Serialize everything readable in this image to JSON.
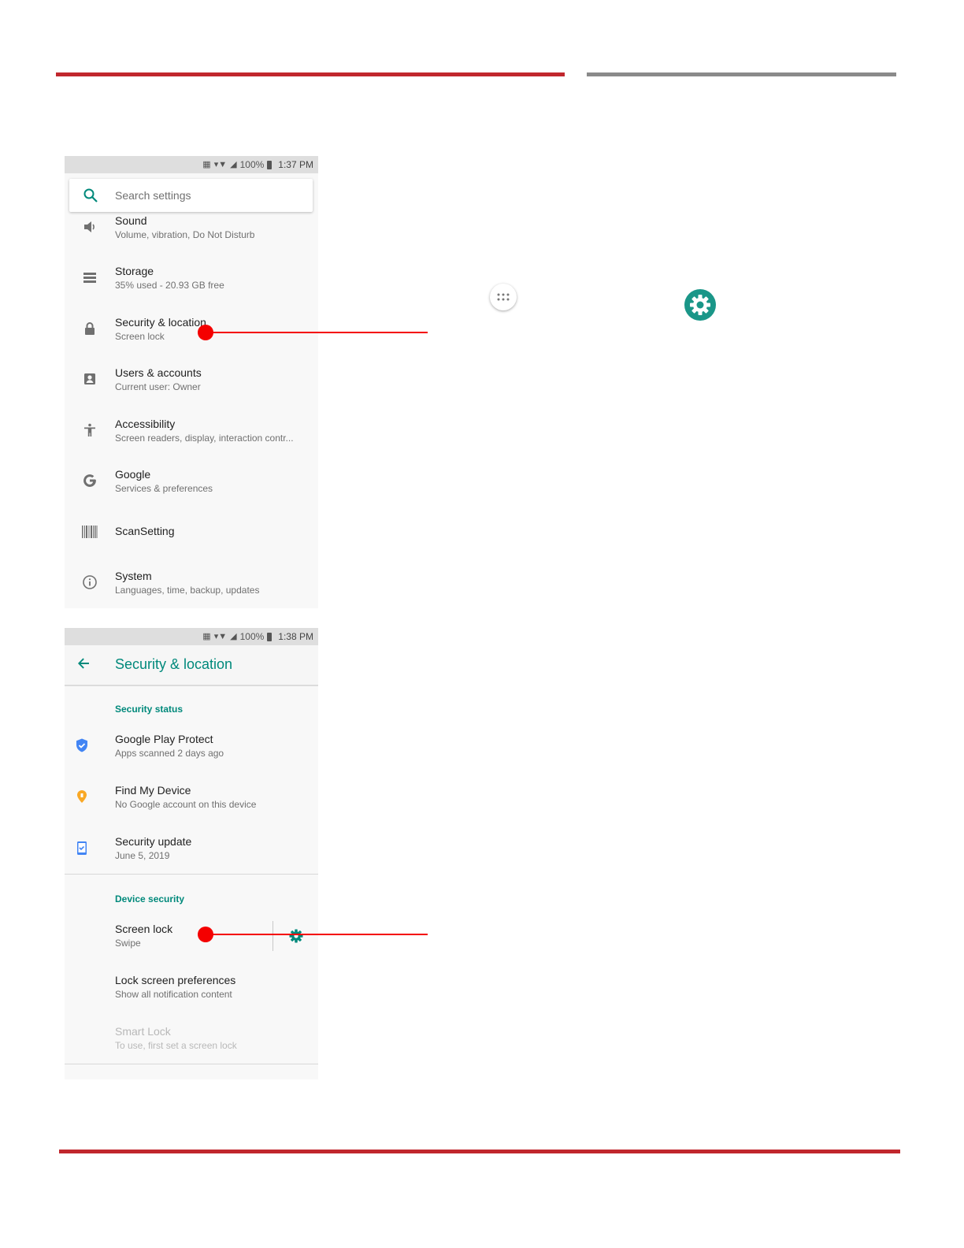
{
  "shot1": {
    "status": {
      "battery": "100%",
      "time": "1:37 PM"
    },
    "search_placeholder": "Search settings",
    "items": [
      {
        "title": "Sound",
        "subtitle": "Volume, vibration, Do Not Disturb",
        "icon": "volume-icon"
      },
      {
        "title": "Storage",
        "subtitle": "35% used - 20.93 GB free",
        "icon": "storage-icon"
      },
      {
        "title": "Security & location",
        "subtitle": "Screen lock",
        "icon": "lock-icon"
      },
      {
        "title": "Users & accounts",
        "subtitle": "Current user: Owner",
        "icon": "account-icon"
      },
      {
        "title": "Accessibility",
        "subtitle": "Screen readers, display, interaction contr...",
        "icon": "accessibility-icon"
      },
      {
        "title": "Google",
        "subtitle": "Services & preferences",
        "icon": "google-icon"
      },
      {
        "title": "ScanSetting",
        "subtitle": "",
        "icon": "barcode-icon"
      },
      {
        "title": "System",
        "subtitle": "Languages, time, backup, updates",
        "icon": "info-icon"
      }
    ]
  },
  "shot2": {
    "status": {
      "battery": "100%",
      "time": "1:38 PM"
    },
    "title": "Security & location",
    "section_status": "Security status",
    "status_items": [
      {
        "title": "Google Play Protect",
        "subtitle": "Apps scanned 2 days ago",
        "icon": "shield-icon",
        "color": "#4285f4"
      },
      {
        "title": "Find My Device",
        "subtitle": "No Google account on this device",
        "icon": "locate-icon",
        "color": "#f9a825"
      },
      {
        "title": "Security update",
        "subtitle": "June 5, 2019",
        "icon": "update-icon",
        "color": "#4285f4"
      }
    ],
    "section_device": "Device security",
    "device_items": [
      {
        "title": "Screen lock",
        "subtitle": "Swipe"
      },
      {
        "title": "Lock screen preferences",
        "subtitle": "Show all notification content"
      },
      {
        "title": "Smart Lock",
        "subtitle": "To use, first set a screen lock"
      }
    ]
  },
  "colors": {
    "accent": "#00897b",
    "rule_red": "#c1272d",
    "rule_gray": "#8a8a8a",
    "callout": "#f40000"
  }
}
